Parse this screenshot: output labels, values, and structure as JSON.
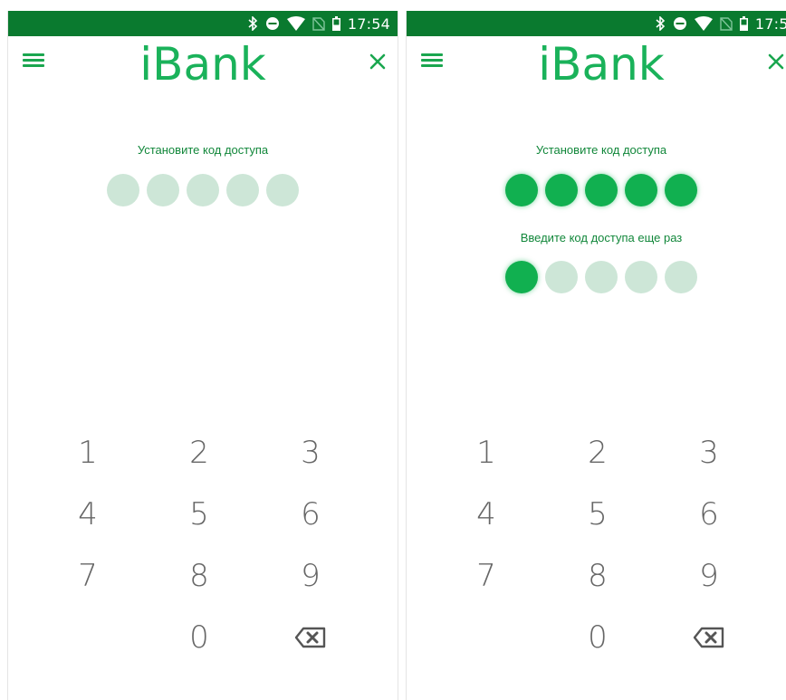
{
  "status_bar": {
    "time": "17:54",
    "icons": [
      "bluetooth-icon",
      "do-not-disturb-icon",
      "wifi-icon",
      "no-sim-icon",
      "battery-icon"
    ]
  },
  "colors": {
    "status_bar": "#0a7a2f",
    "brand": "#1ab25a",
    "dot_filled": "#11b050",
    "dot_empty": "#cde6d7",
    "prompt": "#11873a"
  },
  "header": {
    "logo": "iBank",
    "menu_icon": "hamburger-icon",
    "close_icon": "close-icon"
  },
  "screens": [
    {
      "prompt_set": "Установите код доступа",
      "pin_filled": 0,
      "pin_length": 5
    },
    {
      "prompt_set": "Установите код доступа",
      "pin_filled": 5,
      "prompt_confirm": "Введите код доступа еще раз",
      "confirm_filled": 1,
      "pin_length": 5
    }
  ],
  "keypad": {
    "keys": [
      "1",
      "2",
      "3",
      "4",
      "5",
      "6",
      "7",
      "8",
      "9",
      "",
      "0",
      "backspace-icon"
    ]
  }
}
